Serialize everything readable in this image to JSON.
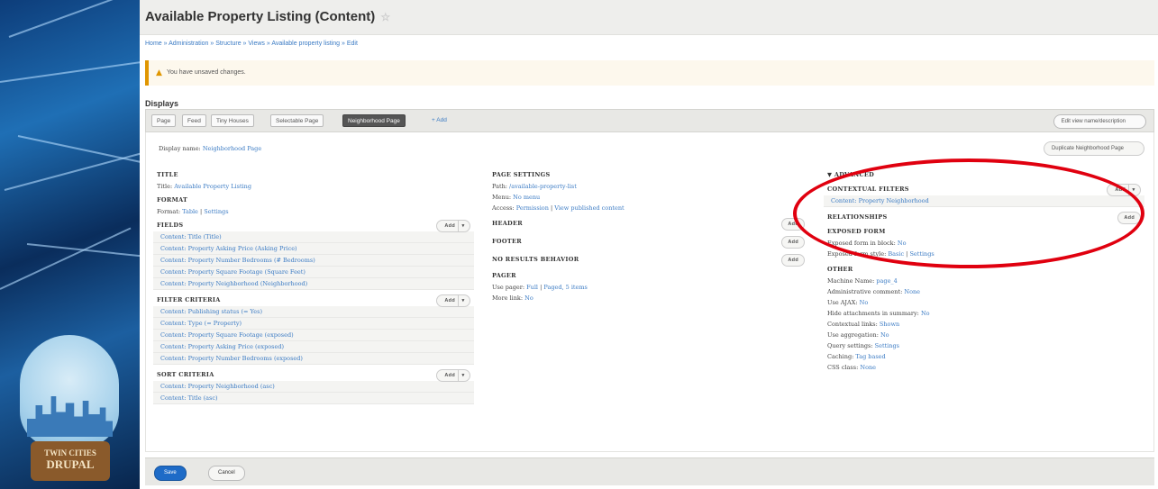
{
  "page": {
    "title": "Available Property Listing (Content)",
    "star_icon": "star-icon"
  },
  "breadcrumb": "Home » Administration » Structure » Views » Available property listing » Edit",
  "warning": {
    "icon": "warning-icon",
    "text": "You have unsaved changes."
  },
  "displays_heading": "Displays",
  "tabs": [
    {
      "label": "Page",
      "active": false
    },
    {
      "label": "Feed",
      "active": false
    },
    {
      "label": "Tiny Houses",
      "active": false
    },
    {
      "label": "Selectable Page",
      "active": false
    },
    {
      "label": "Neighborhood Page",
      "active": true
    },
    {
      "label": "+ Add",
      "active": false
    }
  ],
  "edit_description": "Edit view name/description",
  "display_name": {
    "label": "Display name:",
    "value": "Neighborhood Page"
  },
  "duplicate_button": "Duplicate Neighborhood Page",
  "left": {
    "title": {
      "heading": "TITLE",
      "row_label": "Title:",
      "row_value": "Available Property Listing"
    },
    "format": {
      "heading": "FORMAT",
      "label": "Format:",
      "value": "Table",
      "sep": "|",
      "settings": "Settings"
    },
    "fields": {
      "heading": "FIELDS",
      "add": "Add",
      "items": [
        "Content: Title (Title)",
        "Content: Property Asking Price (Asking Price)",
        "Content: Property Number Bedrooms (# Bedrooms)",
        "Content: Property Square Footage (Square Feet)",
        "Content: Property Neighborhood (Neighborhood)"
      ]
    },
    "filter": {
      "heading": "FILTER CRITERIA",
      "add": "Add",
      "items": [
        "Content: Publishing status (= Yes)",
        "Content: Type (= Property)",
        "Content: Property Square Footage (exposed)",
        "Content: Property Asking Price (exposed)",
        "Content: Property Number Bedrooms (exposed)"
      ]
    },
    "sort": {
      "heading": "SORT CRITERIA",
      "add": "Add",
      "items": [
        "Content: Property Neighborhood (asc)",
        "Content: Title (asc)"
      ]
    }
  },
  "middle": {
    "page_settings": {
      "heading": "PAGE SETTINGS",
      "rows": [
        {
          "label": "Path:",
          "value": "/available-property-list"
        },
        {
          "label": "Menu:",
          "value": "No menu"
        },
        {
          "label": "Access:",
          "value": "Permission",
          "sep": "|",
          "value2": "View published content"
        }
      ]
    },
    "header": {
      "heading": "HEADER",
      "add": "Add"
    },
    "footer": {
      "heading": "FOOTER",
      "add": "Add"
    },
    "no_results": {
      "heading": "NO RESULTS BEHAVIOR",
      "add": "Add"
    },
    "pager": {
      "heading": "PAGER",
      "rows": [
        {
          "label": "Use pager:",
          "value": "Full",
          "sep": "|",
          "value2": "Paged, 5 items"
        },
        {
          "label": "More link:",
          "value": "No"
        }
      ]
    }
  },
  "right": {
    "advanced": "▼ ADVANCED",
    "contextual": {
      "heading": "CONTEXTUAL FILTERS",
      "add": "Add",
      "item": "Content: Property Neighborhood"
    },
    "relationships": {
      "heading": "RELATIONSHIPS",
      "add": "Add"
    },
    "exposed": {
      "heading": "EXPOSED FORM",
      "rows": [
        {
          "label": "Exposed form in block:",
          "value": "No"
        },
        {
          "label": "Exposed form style:",
          "value": "Basic",
          "sep": "|",
          "value2": "Settings"
        }
      ]
    },
    "other": {
      "heading": "OTHER",
      "rows": [
        {
          "label": "Machine Name:",
          "value": "page_4"
        },
        {
          "label": "Administrative comment:",
          "value": "None"
        },
        {
          "label": "Use AJAX:",
          "value": "No"
        },
        {
          "label": "Hide attachments in summary:",
          "value": "No"
        },
        {
          "label": "Contextual links:",
          "value": "Shown"
        },
        {
          "label": "Use aggregation:",
          "value": "No"
        },
        {
          "label": "Query settings:",
          "value": "Settings"
        },
        {
          "label": "Caching:",
          "value": "Tag based"
        },
        {
          "label": "CSS class:",
          "value": "None"
        }
      ]
    }
  },
  "buttons": {
    "save": "Save",
    "cancel": "Cancel"
  },
  "badge": {
    "line1": "TWIN CITIES",
    "line2": "DRUPAL"
  },
  "colors": {
    "link": "#3b7bc4",
    "annotation": "#e0000f",
    "primary": "#1e6bc7"
  }
}
